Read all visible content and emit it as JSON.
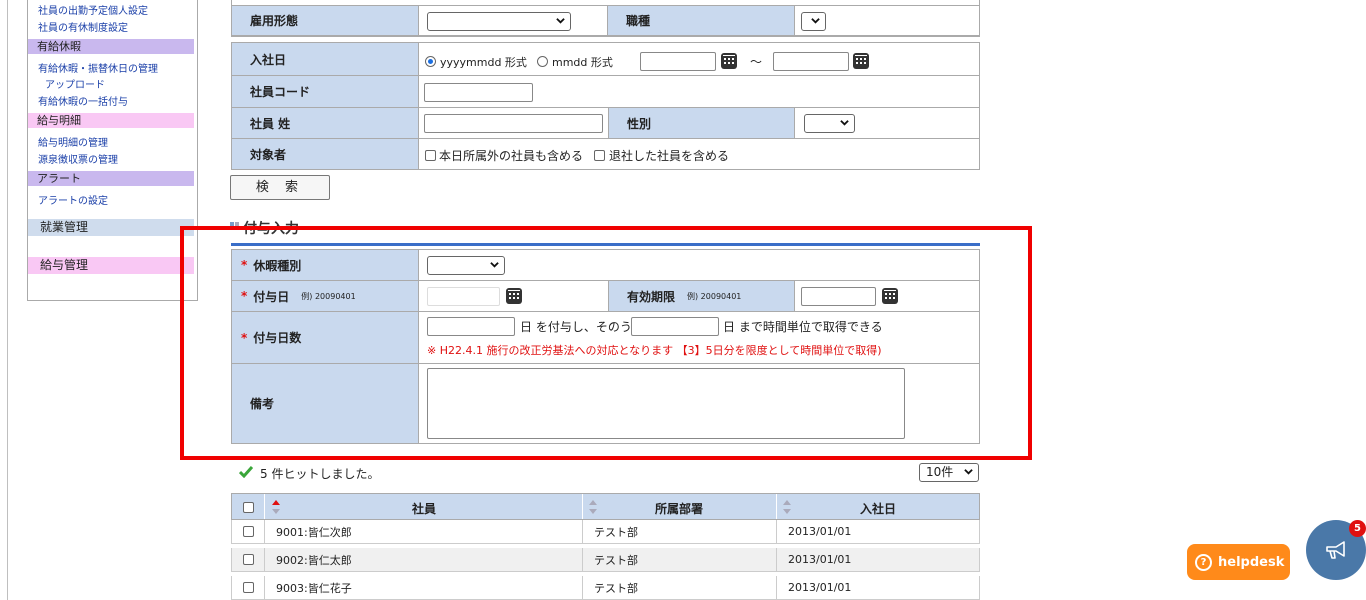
{
  "sidebar": {
    "links_top": [
      "社員の出勤予定個人設定",
      "社員の有休制度設定"
    ],
    "sec_paid_leave": "有給休暇",
    "paid_leave_links": [
      "有給休暇・振替休日の管理",
      "アップロード",
      "有給休暇の一括付与"
    ],
    "sec_payslip": "給与明細",
    "payslip_links": [
      "給与明細の管理",
      "源泉徴収票の管理"
    ],
    "sec_alert": "アラート",
    "alert_links": [
      "アラートの設定"
    ],
    "work_mgmt": "就業管理",
    "payroll_mgmt": "給与管理"
  },
  "search": {
    "employment_type_label": "雇用形態",
    "job_type_label": "職種",
    "hire_date_label": "入社日",
    "radio_yyyymmdd": "yyyymmdd 形式",
    "radio_mmdd": "mmdd 形式",
    "tilde": "～",
    "employee_code_label": "社員コード",
    "last_name_label": "社員 姓",
    "gender_label": "性別",
    "target_label": "対象者",
    "cb_other_dept": "本日所属外の社員も含める",
    "cb_retired": "退社した社員を含める",
    "search_button": "検 索"
  },
  "grant": {
    "section_title": "付与入力",
    "required_mark": "*",
    "leave_type_label": "休暇種別",
    "grant_date_label": "付与日",
    "grant_date_example": "例) 20090401",
    "expiry_label": "有効期限",
    "expiry_example": "例) 20090401",
    "grant_days_label": "付与日数",
    "days_text1": "日 を付与し、そのうち",
    "days_text2": "日 まで時間単位で取得できる",
    "notice": "※ H22.4.1 施行の改正労基法への対応となります 【3】5日分を限度として時間単位で取得)",
    "remarks_label": "備考"
  },
  "results": {
    "hit_text": "5 件ヒットしました。",
    "per_page": "10件",
    "columns": [
      "社員",
      "所属部署",
      "入社日"
    ],
    "rows": [
      {
        "employee": "9001:皆仁次郎",
        "dept": "テスト部",
        "hire_date": "2013/01/01"
      },
      {
        "employee": "9002:皆仁太郎",
        "dept": "テスト部",
        "hire_date": "2013/01/01"
      },
      {
        "employee": "9003:皆仁花子",
        "dept": "テスト部",
        "hire_date": "2013/01/01"
      }
    ]
  },
  "widgets": {
    "helpdesk_label": "helpdesk",
    "notification_count": "5"
  },
  "colors": {
    "header_blue": "#c9d9ee",
    "highlight_red": "#f00000",
    "helpdesk_orange": "#ff8a1a",
    "link_blue": "#1a3fa8"
  }
}
